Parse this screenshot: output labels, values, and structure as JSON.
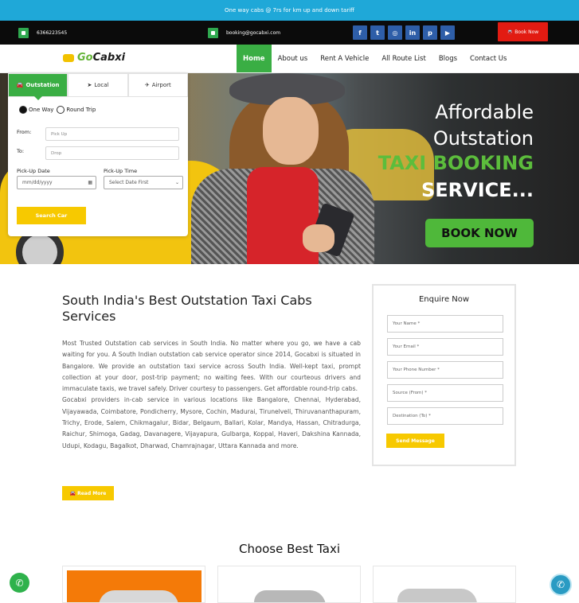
{
  "topbar": {
    "text": "One way cabs @ 7rs for km up and down tariff"
  },
  "contact": {
    "phone": "6366223545",
    "email": "booking@gocabxi.com",
    "book_now": "Book Now",
    "social": [
      {
        "icon": "facebook-icon",
        "glyph": "f"
      },
      {
        "icon": "twitter-icon",
        "glyph": "t"
      },
      {
        "icon": "instagram-icon",
        "glyph": "◎"
      },
      {
        "icon": "linkedin-icon",
        "glyph": "in"
      },
      {
        "icon": "pinterest-icon",
        "glyph": "p"
      },
      {
        "icon": "youtube-icon",
        "glyph": "▶"
      }
    ]
  },
  "brand": {
    "logo_go": "Go",
    "logo_rest": "Cabxi"
  },
  "nav": {
    "items": [
      "Home",
      "About us",
      "Rent A Vehicle",
      "All Route List",
      "Blogs",
      "Contact Us"
    ],
    "active": "Home"
  },
  "booking": {
    "tabs": [
      "Outstation",
      "Local",
      "Airport"
    ],
    "trip_types": [
      "One Way",
      "Round Trip"
    ],
    "from_label": "From:",
    "from_placeholder": "Pick Up",
    "to_label": "To:",
    "to_placeholder": "Drop",
    "date_label": "Pick-Up Date",
    "date_value": "mm/dd/yyyy",
    "time_label": "Pick-Up Time",
    "time_value": "Select Date First",
    "search_button": "Search Car"
  },
  "hero": {
    "line1": "Affordable",
    "line2": "Outstation",
    "line3": "TAXI BOOKING",
    "line4": "SERVICE...",
    "cta": "BOOK NOW"
  },
  "about": {
    "title": "South India's Best Outstation Taxi Cabs Services",
    "paragraph1": "Most Trusted Outstation cab services in South India. No matter where you go, we have a cab waiting for you. A South Indian outstation cab service operator since 2014, Gocabxi is situated in Bangalore. We provide an outstation taxi service across South India. Well-kept taxi, prompt collection at your door, post-trip payment; no waiting fees. With our courteous drivers and immaculate taxis, we travel safely. Driver courtesy to passengers. Get affordable round-trip cabs.",
    "paragraph2": "Gocabxi providers in-cab service in various locations like Bangalore, Chennai, Hyderabad, Vijayawada, Coimbatore, Pondicherry, Mysore, Cochin, Madurai, Tirunelveli, Thiruvananthapuram, Trichy, Erode, Salem, Chikmagalur, Bidar, Belgaum, Ballari, Kolar, Mandya, Hassan, Chitradurga, Raichur, Shimoga, Gadag, Davanagere, Vijayapura, Gulbarga, Koppal, Haveri, Dakshina Kannada, Udupi, Kodagu, Bagalkot, Dharwad, Chamrajnagar, Uttara Kannada and more.",
    "read_more": "Read More"
  },
  "enquiry": {
    "title": "Enquire Now",
    "fields": [
      "Your Name *",
      "Your Email *",
      "Your Phone Number *",
      "Source (From) *",
      "Destination (To) *"
    ],
    "submit": "Send Message"
  },
  "choose": {
    "title": "Choose Best Taxi"
  },
  "colors": {
    "accent_green": "#3aae44",
    "accent_yellow": "#f7c900",
    "topbar_blue": "#1fa8d8",
    "cta_red": "#e21b12"
  }
}
